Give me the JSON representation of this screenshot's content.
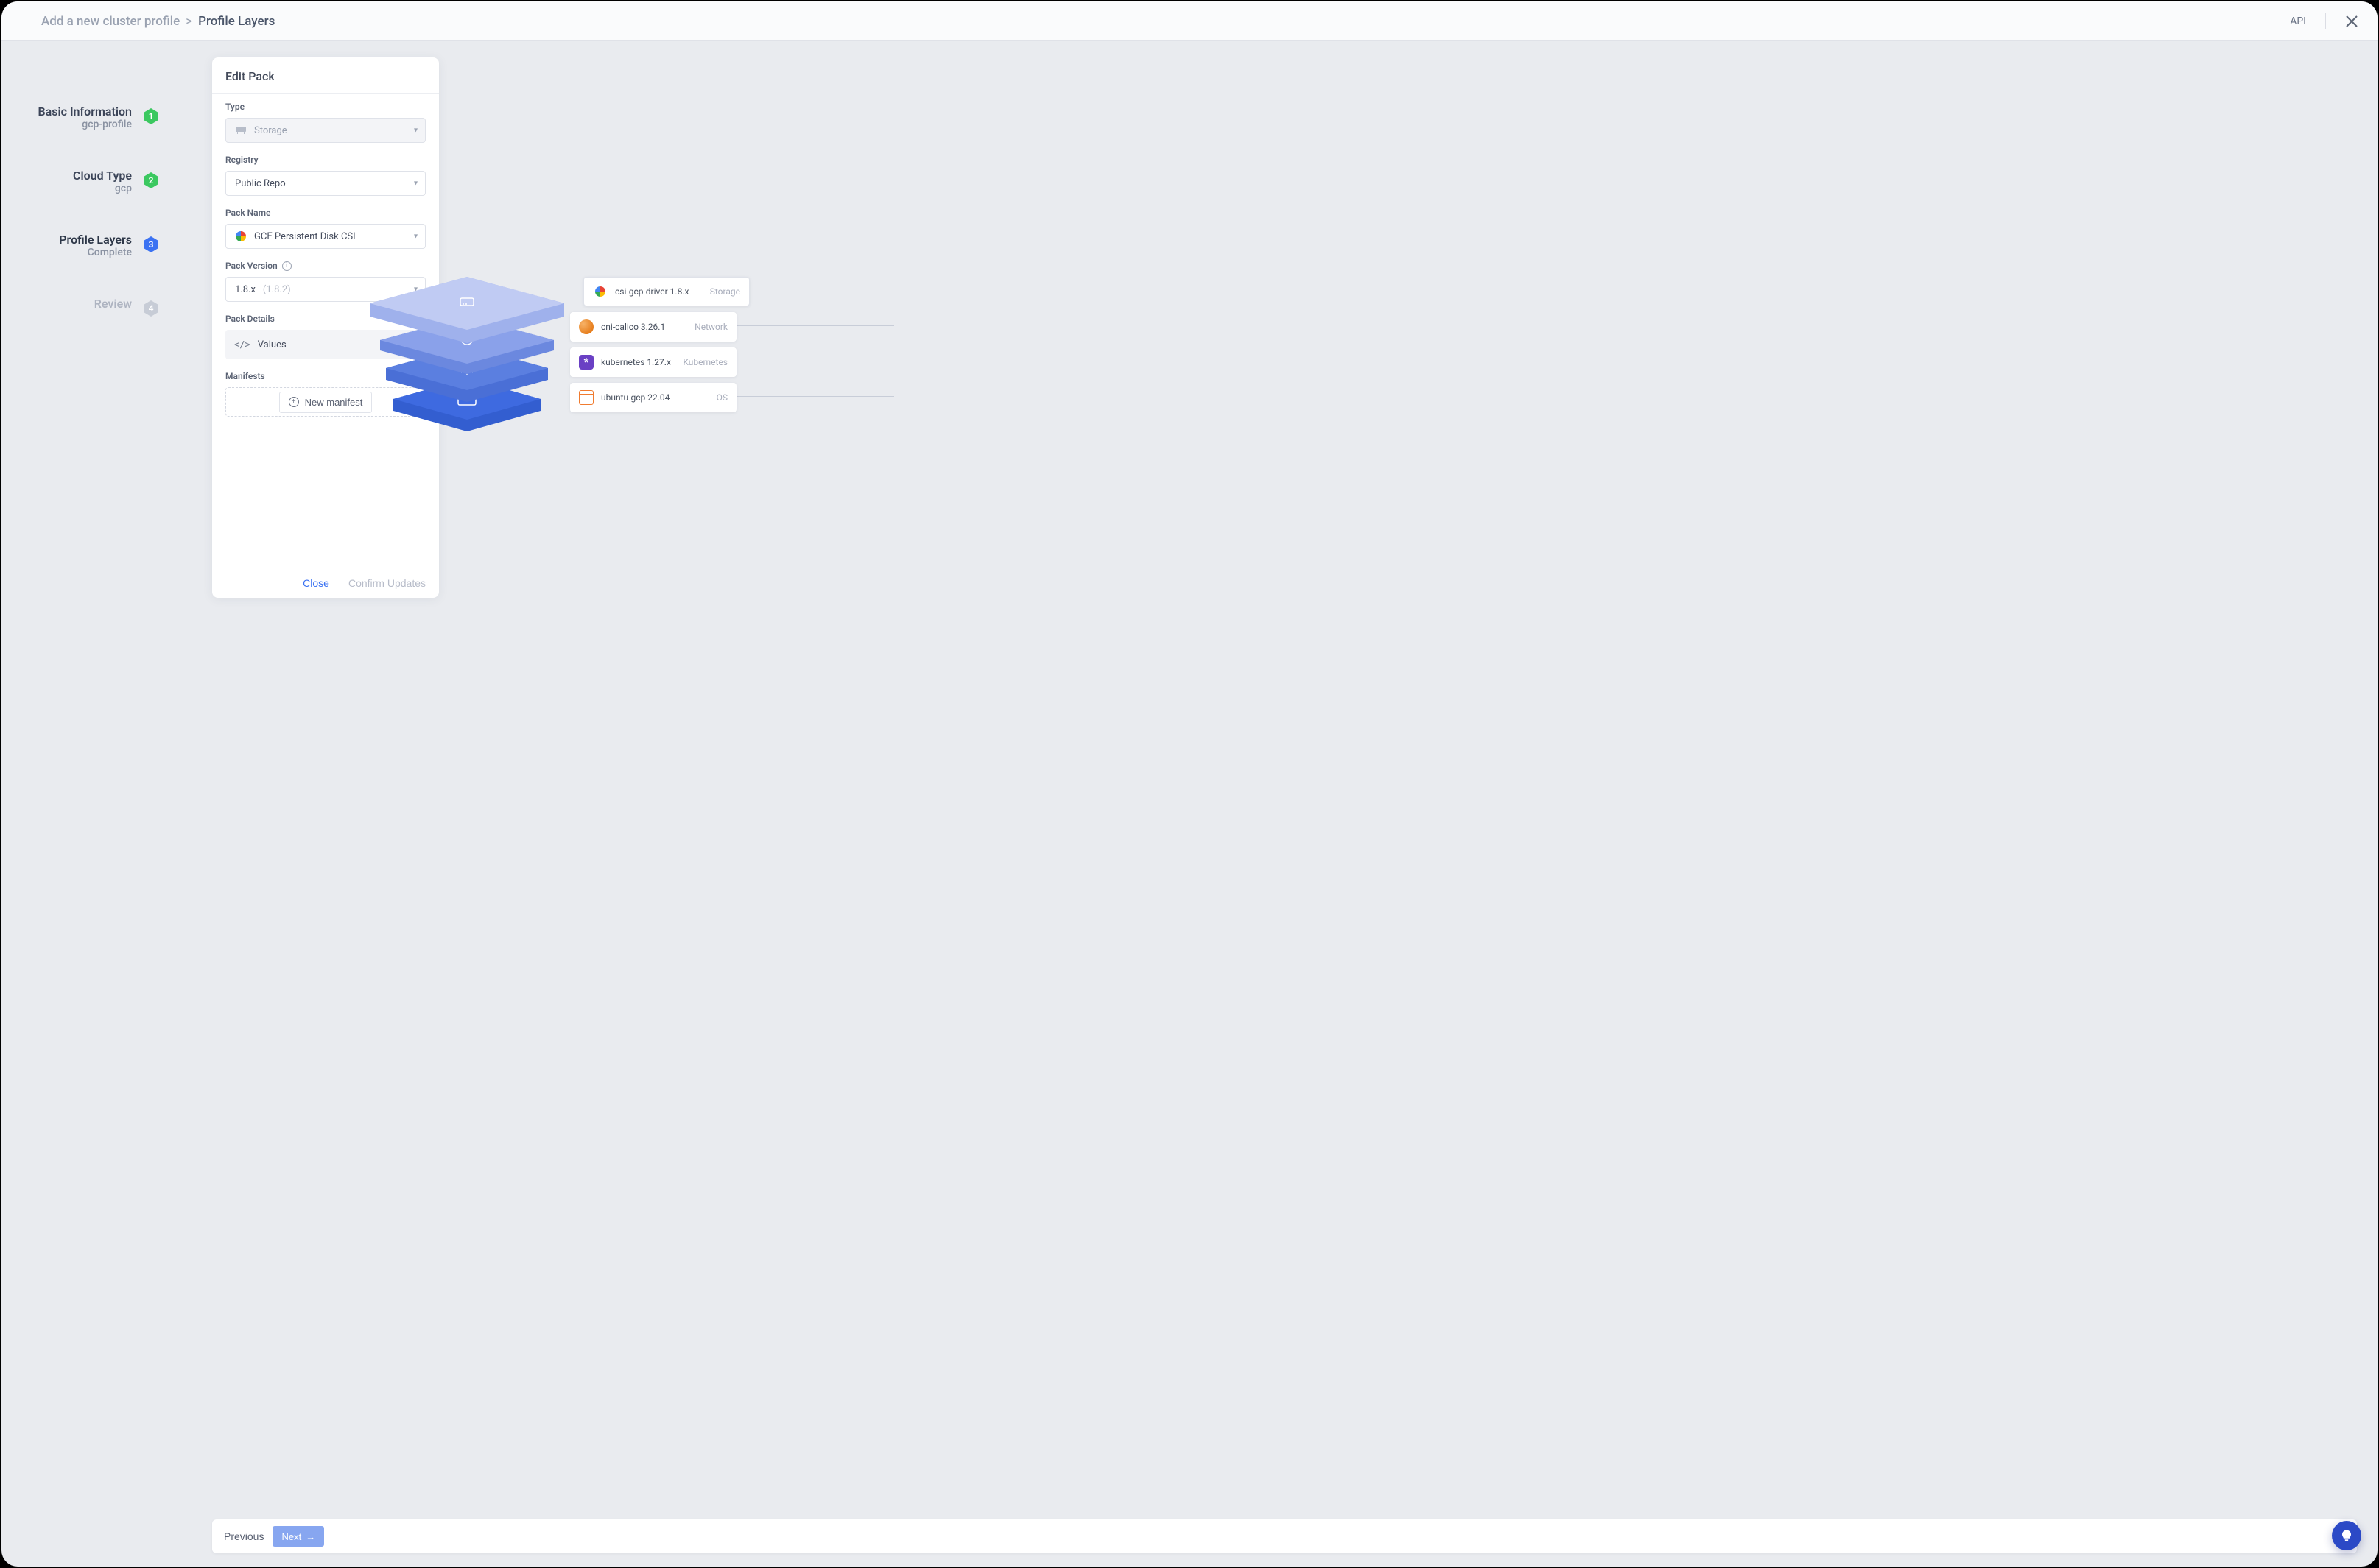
{
  "header": {
    "breadcrumb_main": "Add a new cluster profile",
    "breadcrumb_sub": "Profile Layers",
    "api_label": "API"
  },
  "steps": [
    {
      "title": "Basic Information",
      "sub": "gcp-profile",
      "num": "1",
      "state": "done"
    },
    {
      "title": "Cloud Type",
      "sub": "gcp",
      "num": "2",
      "state": "done"
    },
    {
      "title": "Profile Layers",
      "sub": "Complete",
      "num": "3",
      "state": "current"
    },
    {
      "title": "Review",
      "sub": "",
      "num": "4",
      "state": "future"
    }
  ],
  "card": {
    "title": "Edit Pack",
    "type_label": "Type",
    "type_value": "Storage",
    "registry_label": "Registry",
    "registry_value": "Public Repo",
    "packname_label": "Pack Name",
    "packname_value": "GCE Persistent Disk CSI",
    "version_label": "Pack Version",
    "version_value": "1.8.x",
    "version_exact": "(1.8.2)",
    "details_label": "Pack Details",
    "values_label": "Values",
    "manifests_label": "Manifests",
    "new_manifest": "New manifest",
    "close": "Close",
    "confirm": "Confirm Updates"
  },
  "layers": [
    {
      "name": "csi-gcp-driver 1.8.x",
      "tag": "Storage",
      "icon": "gcp",
      "active": true
    },
    {
      "name": "cni-calico 3.26.1",
      "tag": "Network",
      "icon": "calico",
      "active": false
    },
    {
      "name": "kubernetes 1.27.x",
      "tag": "Kubernetes",
      "icon": "k8s",
      "active": false
    },
    {
      "name": "ubuntu-gcp 22.04",
      "tag": "OS",
      "icon": "os",
      "active": false
    }
  ],
  "footer": {
    "previous": "Previous",
    "next": "Next"
  }
}
